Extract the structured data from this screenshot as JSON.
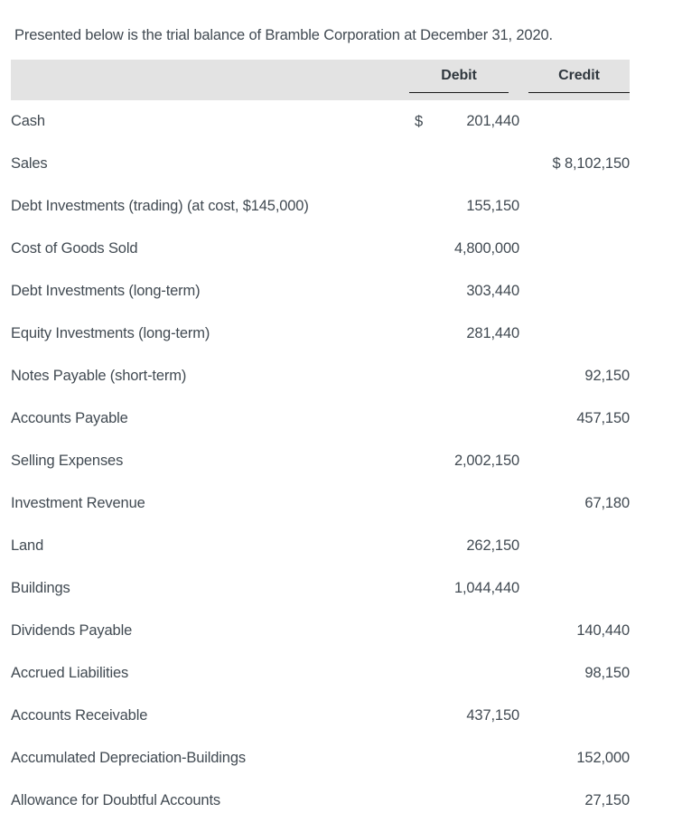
{
  "intro": {
    "text": "Presented below is the trial balance of Bramble Corporation at December 31, 2020."
  },
  "table": {
    "headers": {
      "account": "",
      "debit": "Debit",
      "credit": "Credit"
    },
    "header_background": "#e3e3e3",
    "rows": [
      {
        "account": "Cash",
        "debit_currency": "$",
        "debit": "201,440",
        "credit": ""
      },
      {
        "account": "Sales",
        "debit_currency": "",
        "debit": "",
        "credit": "$ 8,102,150"
      },
      {
        "account": "Debt Investments (trading) (at cost, $145,000)",
        "debit_currency": "",
        "debit": "155,150",
        "credit": ""
      },
      {
        "account": "Cost of Goods Sold",
        "debit_currency": "",
        "debit": "4,800,000",
        "credit": ""
      },
      {
        "account": "Debt Investments (long-term)",
        "debit_currency": "",
        "debit": "303,440",
        "credit": ""
      },
      {
        "account": "Equity Investments (long-term)",
        "debit_currency": "",
        "debit": "281,440",
        "credit": ""
      },
      {
        "account": "Notes Payable (short-term)",
        "debit_currency": "",
        "debit": "",
        "credit": "92,150"
      },
      {
        "account": "Accounts Payable",
        "debit_currency": "",
        "debit": "",
        "credit": "457,150"
      },
      {
        "account": "Selling Expenses",
        "debit_currency": "",
        "debit": "2,002,150",
        "credit": ""
      },
      {
        "account": "Investment Revenue",
        "debit_currency": "",
        "debit": "",
        "credit": "67,180"
      },
      {
        "account": "Land",
        "debit_currency": "",
        "debit": "262,150",
        "credit": ""
      },
      {
        "account": "Buildings",
        "debit_currency": "",
        "debit": "1,044,440",
        "credit": ""
      },
      {
        "account": "Dividends Payable",
        "debit_currency": "",
        "debit": "",
        "credit": "140,440"
      },
      {
        "account": "Accrued Liabilities",
        "debit_currency": "",
        "debit": "",
        "credit": "98,150"
      },
      {
        "account": "Accounts Receivable",
        "debit_currency": "",
        "debit": "437,150",
        "credit": ""
      },
      {
        "account": "Accumulated Depreciation-Buildings",
        "debit_currency": "",
        "debit": "",
        "credit": "152,000"
      },
      {
        "account": "Allowance for Doubtful Accounts",
        "debit_currency": "",
        "debit": "",
        "credit": "27,150"
      }
    ]
  }
}
